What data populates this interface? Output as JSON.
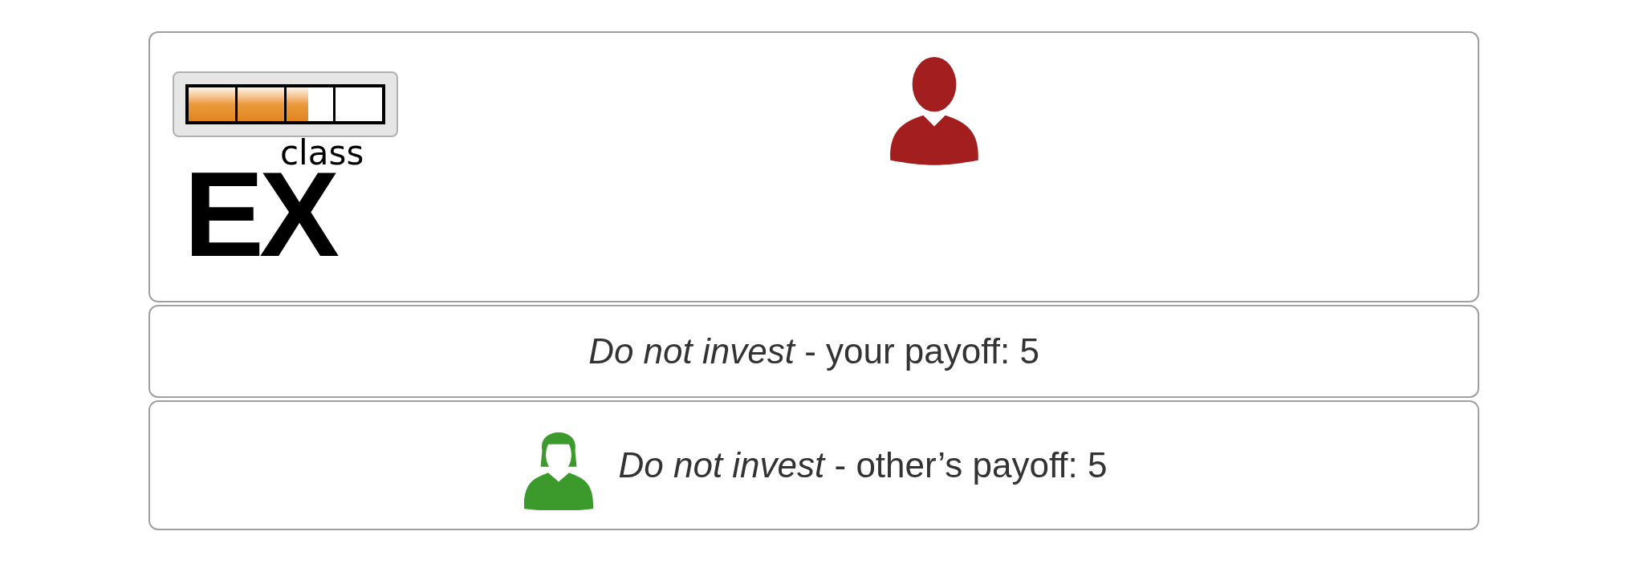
{
  "logo": {
    "superscript": "class",
    "main": "EX",
    "level": 0.62
  },
  "decision": {
    "text": "*Do not invest* - your payoff: 5"
  },
  "other": {
    "text": "*Do not invest* - other’s payoff: 5"
  }
}
